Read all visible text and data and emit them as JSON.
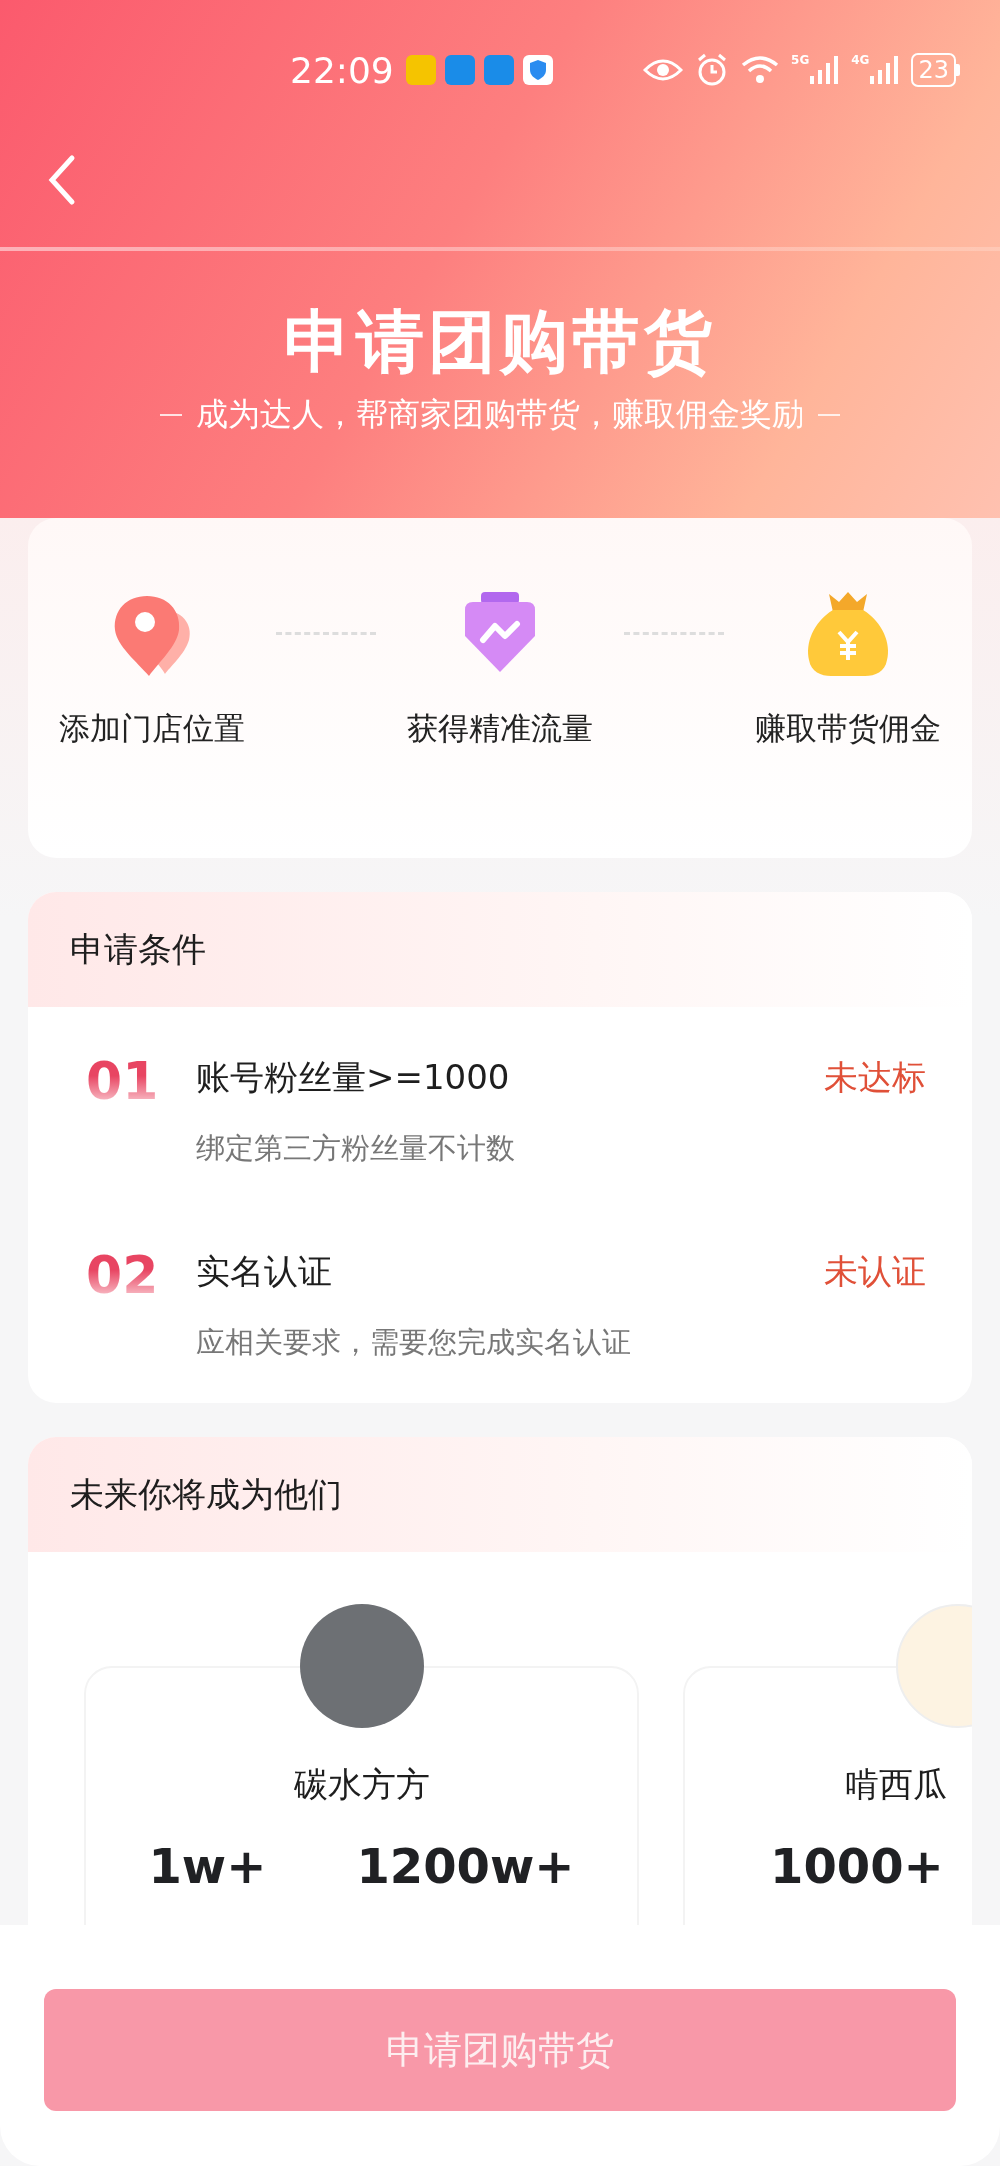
{
  "status_bar": {
    "time": "22:09",
    "network_labels": [
      "5G",
      "4G"
    ],
    "battery": "23"
  },
  "header": {
    "title": "申请团购带货",
    "subtitle": "成为达人，帮商家团购带货，赚取佣金奖励"
  },
  "steps": [
    {
      "kind": "pin",
      "label": "添加门店位置"
    },
    {
      "kind": "shield",
      "label": "获得精准流量"
    },
    {
      "kind": "bag",
      "label": "赚取带货佣金"
    }
  ],
  "conditions": {
    "title": "申请条件",
    "items": [
      {
        "number": "01",
        "title": "账号粉丝量>=1000",
        "note": "绑定第三方粉丝量不计数",
        "status": "未达标"
      },
      {
        "number": "02",
        "title": "实名认证",
        "note": "应相关要求，需要您完成实名认证",
        "status": "未认证"
      }
    ]
  },
  "showcase": {
    "title": "未来你将成为他们",
    "creators": [
      {
        "name": "碳水方方",
        "stats": [
          "1w+",
          "1200w+"
        ]
      },
      {
        "name": "啃西瓜",
        "stats": [
          "1000+"
        ]
      }
    ]
  },
  "apply_button": {
    "label": "申请团购带货",
    "disabled": true
  }
}
